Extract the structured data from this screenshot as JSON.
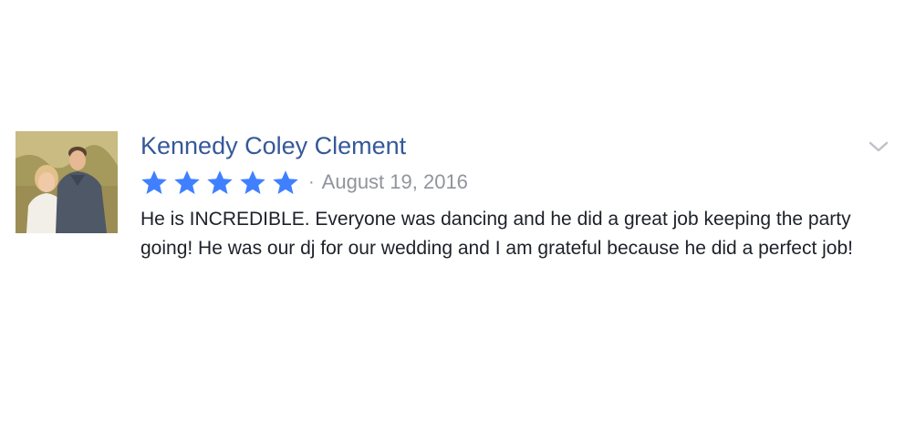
{
  "review": {
    "reviewer_name": "Kennedy Coley Clement",
    "rating": 5,
    "rating_max": 5,
    "separator": "·",
    "date": "August 19, 2016",
    "text": "He is INCREDIBLE. Everyone was dancing and he did a great job keeping the party going! He was our dj for our wedding and I am grateful because he did a perfect job!",
    "avatar_icon": "profile-photo",
    "menu_icon": "chevron-down-icon"
  },
  "colors": {
    "name": "#365899",
    "star": "#4080ff",
    "meta": "#90949c",
    "text": "#1d2129",
    "chevron": "#bec2c9"
  }
}
